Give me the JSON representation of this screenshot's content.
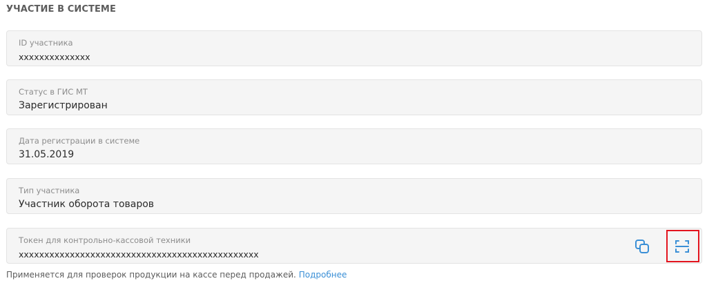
{
  "section": {
    "title": "УЧАСТИЕ В СИСТЕМЕ"
  },
  "fields": [
    {
      "label": "ID участника",
      "value": "xxxxxxxxxxxxxx"
    },
    {
      "label": "Статус в ГИС МТ",
      "value": "Зарегистрирован"
    },
    {
      "label": "Дата регистрации в системе",
      "value": "31.05.2019"
    },
    {
      "label": "Тип участника",
      "value": "Участник оборота товаров"
    },
    {
      "label": "Токен для контрольно-кассовой техники",
      "value": "xxxxxxxxxxxxxxxxxxxxxxxxxxxxxxxxxxxxxxxxxxxxxxx"
    }
  ],
  "token_actions": {
    "copy_icon": "copy-icon",
    "qr_icon": "qr-scan-icon",
    "accent_color": "#3a8fd6",
    "highlight_color": "#e3141e"
  },
  "hint": {
    "text": "Применяется для проверок продукции на кассе перед продажей.",
    "link_text": "Подробнее"
  }
}
